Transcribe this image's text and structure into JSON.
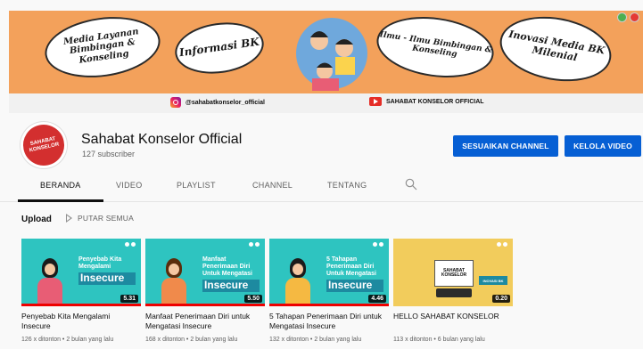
{
  "banner": {
    "bubble1": "Media Layanan Bimbingan & Konseling",
    "bubble2": "Informasi BK",
    "bubble3": "Ilmu - Ilmu Bimbingan & Konseling",
    "bubble4": "Inovasi Media BK Milenial",
    "instagram_handle": "@sahabatkonselor_official",
    "youtube_name": "SAHABAT KONSELOR OFFICIAL"
  },
  "channel": {
    "avatar_text": "SAHABAT KONSELOR",
    "name": "Sahabat Konselor Official",
    "subscribers": "127 subscriber",
    "customize_label": "SESUAIKAN CHANNEL",
    "manage_label": "KELOLA VIDEO"
  },
  "tabs": [
    {
      "label": "BERANDA"
    },
    {
      "label": "VIDEO"
    },
    {
      "label": "PLAYLIST"
    },
    {
      "label": "CHANNEL"
    },
    {
      "label": "TENTANG"
    }
  ],
  "section": {
    "title": "Upload",
    "play_all": "PUTAR SEMUA"
  },
  "videos": [
    {
      "thumb_small": "Penyebab Kita Mengalami",
      "thumb_big": "Insecure",
      "duration": "5.31",
      "title": "Penyebab Kita Mengalami Insecure",
      "meta": "126 x ditonton • 2 bulan yang lalu"
    },
    {
      "thumb_small": "Manfaat Penerimaan Diri Untuk Mengatasi",
      "thumb_big": "Insecure",
      "duration": "5.50",
      "title": "Manfaat Penerimaan Diri untuk Mengatasi Insecure",
      "meta": "168 x ditonton • 2 bulan yang lalu"
    },
    {
      "thumb_small": "5 Tahapan Penerimaan Diri Untuk Mengatasi",
      "thumb_big": "Insecure",
      "duration": "4.46",
      "title": "5 Tahapan Penerimaan Diri untuk Mengatasi Insecure",
      "meta": "132 x ditonton • 2 bulan yang lalu"
    },
    {
      "thumb_small": "SAHABAT KONSELOR",
      "thumb_big": "INOVASI BK",
      "duration": "0.20",
      "title": "HELLO SAHABAT KONSELOR",
      "meta": "113 x ditonton • 6 bulan yang lalu"
    }
  ],
  "colors": {
    "banner": "#f3a15b",
    "accent_blue": "#065fd4",
    "progress_red": "#ee0000",
    "thumb_teal": "#2ec4c0",
    "thumb_yellow": "#f2cc5c"
  },
  "icons": {
    "instagram": "instagram-icon",
    "youtube": "youtube-icon",
    "search": "search-icon",
    "play_all": "play-icon"
  }
}
